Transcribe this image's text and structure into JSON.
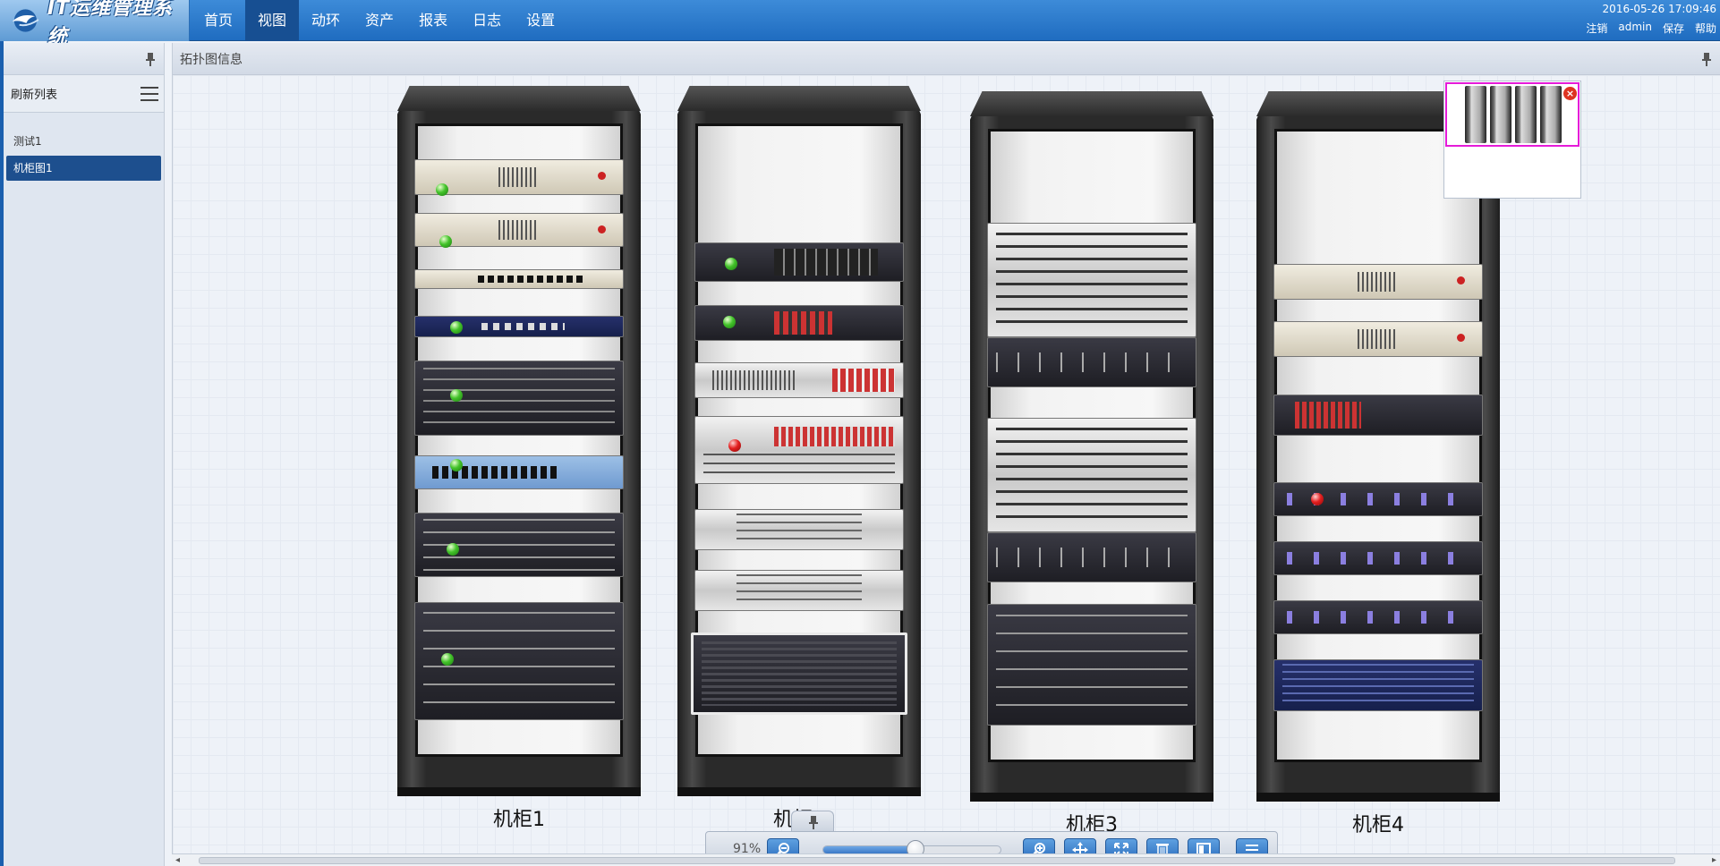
{
  "app": {
    "title": "IT运维管理系统"
  },
  "nav": {
    "items": [
      {
        "label": "首页",
        "active": false
      },
      {
        "label": "视图",
        "active": true
      },
      {
        "label": "动环",
        "active": false
      },
      {
        "label": "资产",
        "active": false
      },
      {
        "label": "报表",
        "active": false
      },
      {
        "label": "日志",
        "active": false
      },
      {
        "label": "设置",
        "active": false
      }
    ]
  },
  "header": {
    "clock": "2016-05-26 17:09:46",
    "links": {
      "logout": "注销",
      "user": "admin",
      "save": "保存",
      "help": "帮助"
    }
  },
  "sidebar": {
    "header": "刷新列表",
    "items": [
      {
        "label": "测试1",
        "active": false
      },
      {
        "label": "机柜图1",
        "active": true
      }
    ]
  },
  "content": {
    "title": "拓扑图信息"
  },
  "racks": [
    {
      "label": "机柜1"
    },
    {
      "label": "机柜2"
    },
    {
      "label": "机柜3"
    },
    {
      "label": "机柜4"
    }
  ],
  "toolbar": {
    "zoom": "91%",
    "zoom_fraction": 0.52
  },
  "colors": {
    "header": "#2a78cc",
    "nav_active": "#174f92",
    "sidebar_active": "#1d4f8e",
    "status_ok": "#43c32a",
    "status_alarm": "#e42020",
    "overview_frame": "#e51bd9"
  },
  "icons": [
    "bird-logo-icon",
    "pin-icon",
    "menu-icon",
    "zoom-out-icon",
    "zoom-in-icon",
    "move-icon",
    "fit-screen-icon",
    "delete-icon",
    "layout-icon",
    "list-icon",
    "close-icon"
  ]
}
